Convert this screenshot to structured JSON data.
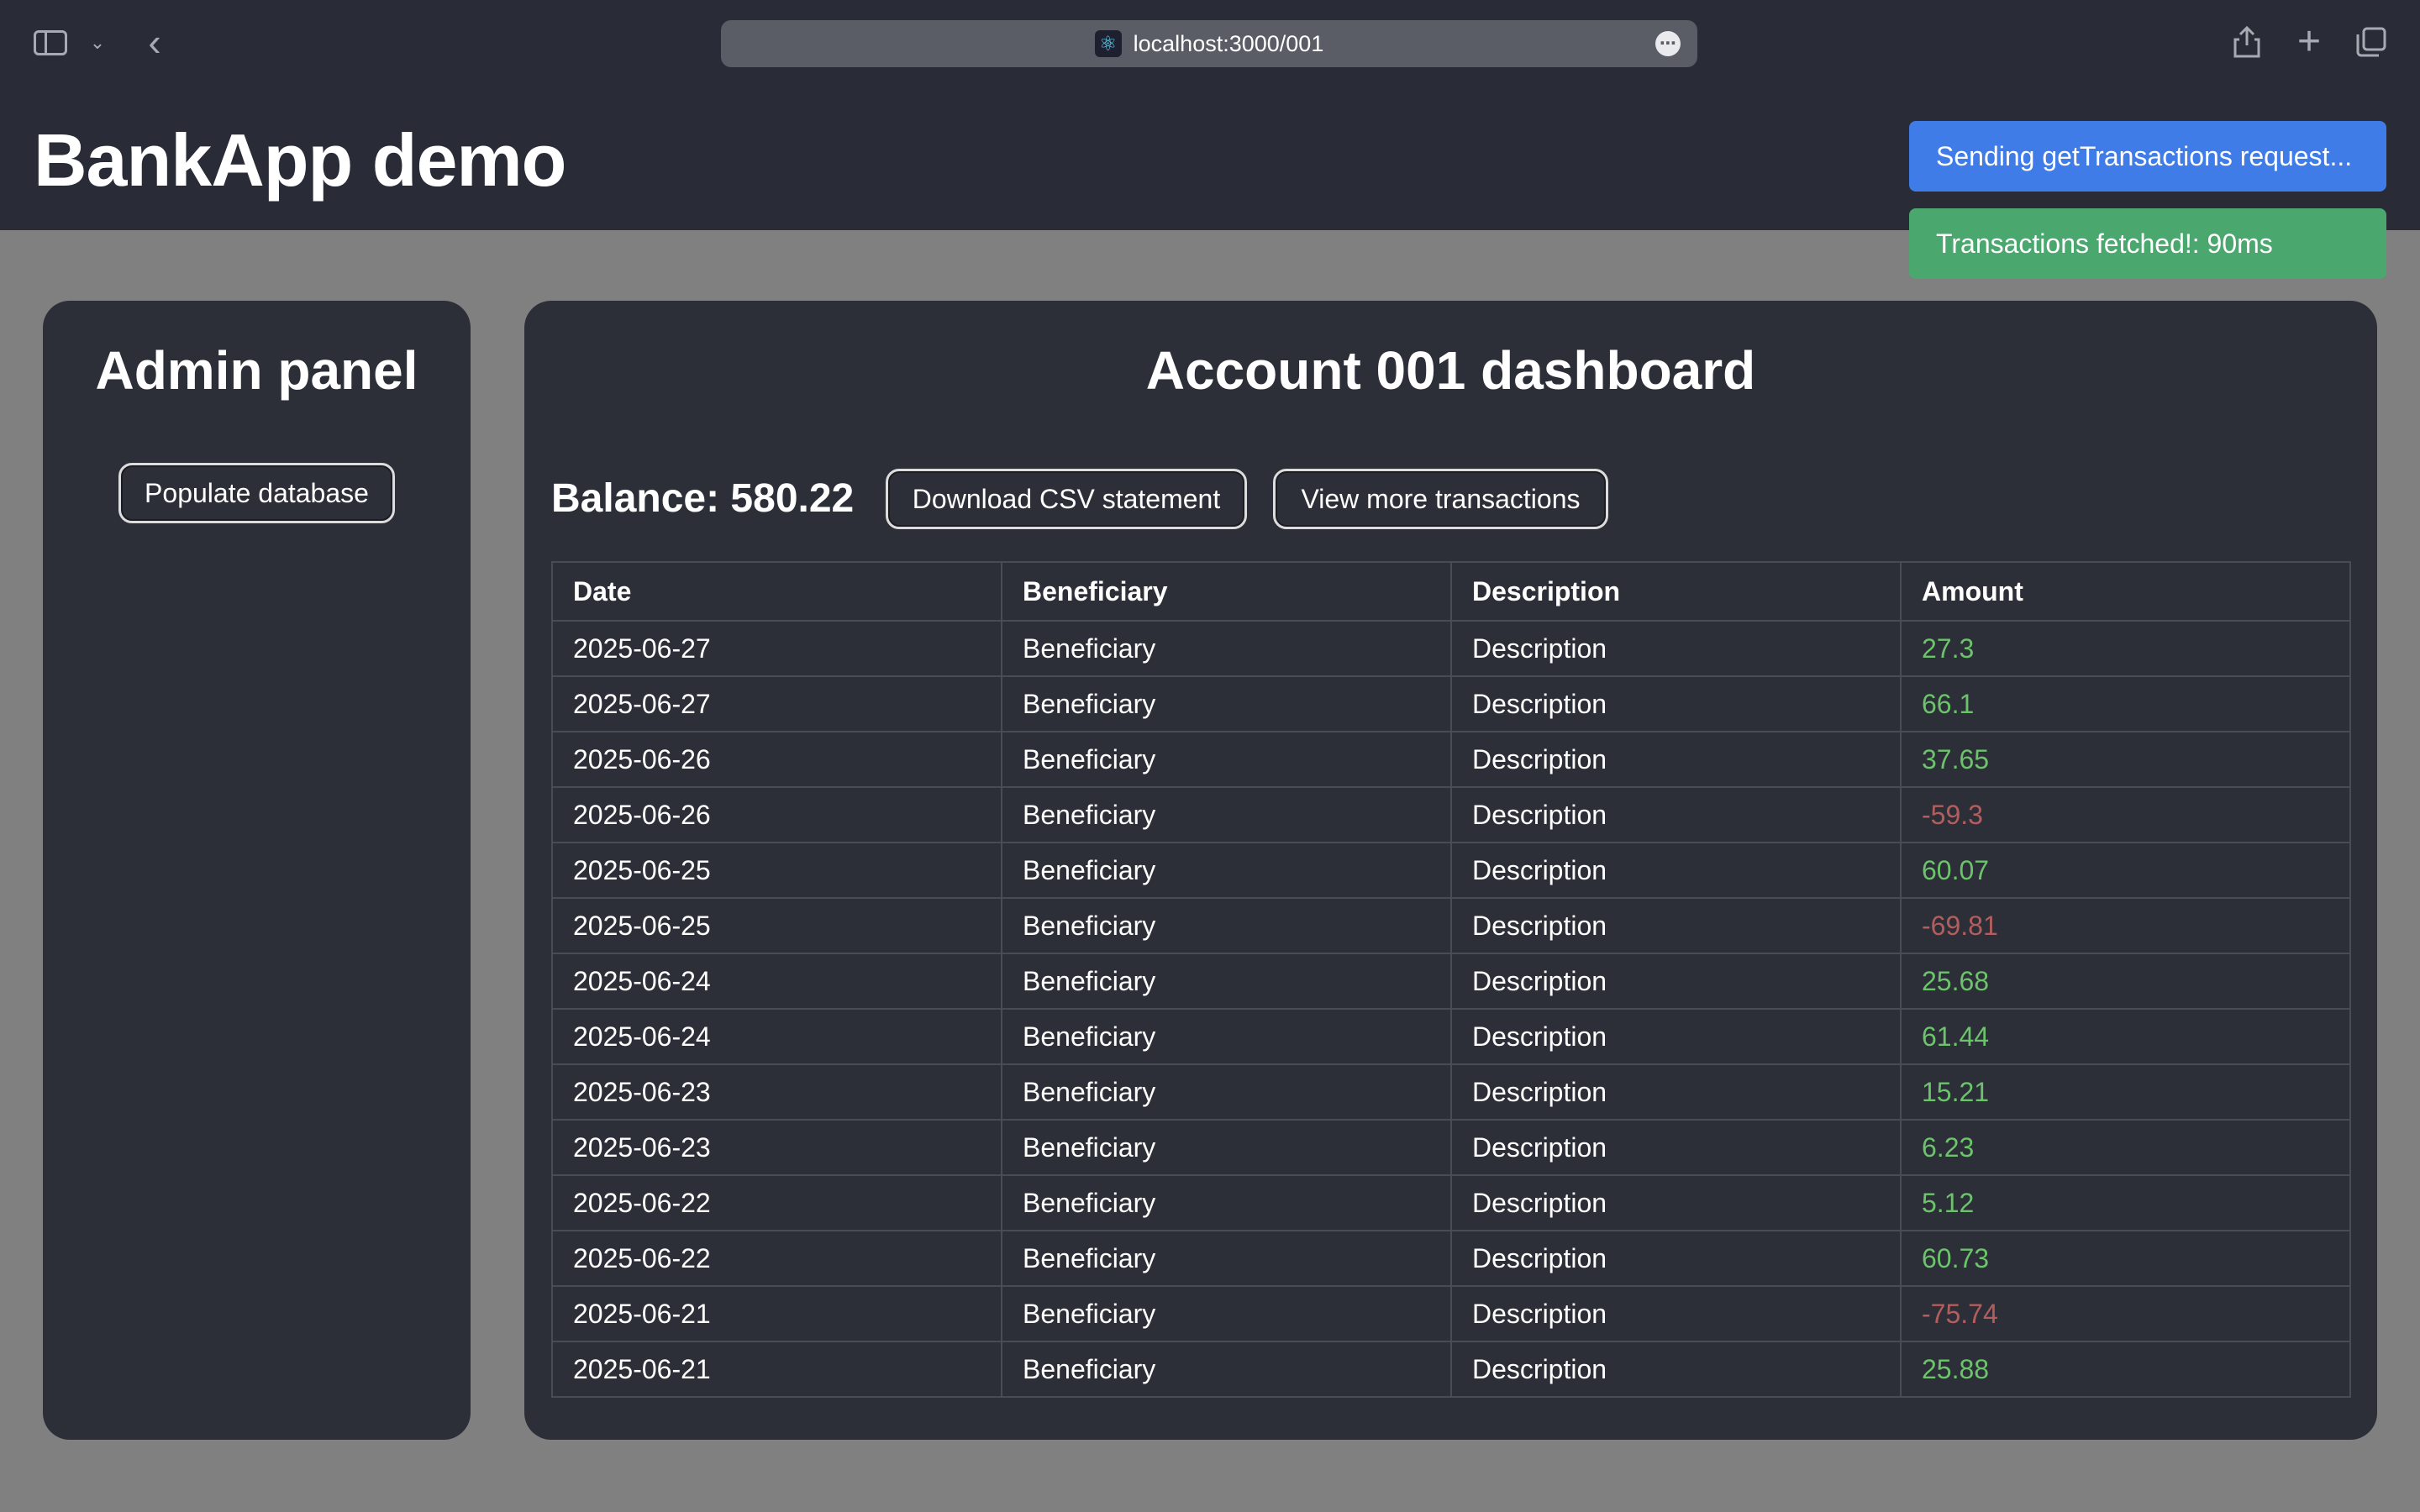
{
  "browser": {
    "url": "localhost:3000/001",
    "icons": [
      "sidebar-icon",
      "chevron-down-icon",
      "back-icon",
      "react-favicon",
      "more-icon",
      "share-icon",
      "plus-icon",
      "tabs-icon"
    ]
  },
  "app": {
    "title": "BankApp demo"
  },
  "toasts": [
    {
      "text": "Sending getTransactions request...",
      "color": "#3f7ce8"
    },
    {
      "text": "Transactions fetched!: 90ms",
      "color": "#4aa86e"
    }
  ],
  "admin": {
    "title": "Admin panel",
    "populate_label": "Populate database"
  },
  "dashboard": {
    "title": "Account 001 dashboard",
    "balance": "Balance: 580.22",
    "csv_label": "Download CSV statement",
    "more_label": "View more transactions",
    "columns": [
      "Date",
      "Beneficiary",
      "Description",
      "Amount"
    ],
    "rows": [
      {
        "date": "2025-06-27",
        "beneficiary": "Beneficiary",
        "description": "Description",
        "amount": "27.3"
      },
      {
        "date": "2025-06-27",
        "beneficiary": "Beneficiary",
        "description": "Description",
        "amount": "66.1"
      },
      {
        "date": "2025-06-26",
        "beneficiary": "Beneficiary",
        "description": "Description",
        "amount": "37.65"
      },
      {
        "date": "2025-06-26",
        "beneficiary": "Beneficiary",
        "description": "Description",
        "amount": "-59.3"
      },
      {
        "date": "2025-06-25",
        "beneficiary": "Beneficiary",
        "description": "Description",
        "amount": "60.07"
      },
      {
        "date": "2025-06-25",
        "beneficiary": "Beneficiary",
        "description": "Description",
        "amount": "-69.81"
      },
      {
        "date": "2025-06-24",
        "beneficiary": "Beneficiary",
        "description": "Description",
        "amount": "25.68"
      },
      {
        "date": "2025-06-24",
        "beneficiary": "Beneficiary",
        "description": "Description",
        "amount": "61.44"
      },
      {
        "date": "2025-06-23",
        "beneficiary": "Beneficiary",
        "description": "Description",
        "amount": "15.21"
      },
      {
        "date": "2025-06-23",
        "beneficiary": "Beneficiary",
        "description": "Description",
        "amount": "6.23"
      },
      {
        "date": "2025-06-22",
        "beneficiary": "Beneficiary",
        "description": "Description",
        "amount": "5.12"
      },
      {
        "date": "2025-06-22",
        "beneficiary": "Beneficiary",
        "description": "Description",
        "amount": "60.73"
      },
      {
        "date": "2025-06-21",
        "beneficiary": "Beneficiary",
        "description": "Description",
        "amount": "-75.74"
      },
      {
        "date": "2025-06-21",
        "beneficiary": "Beneficiary",
        "description": "Description",
        "amount": "25.88"
      }
    ],
    "colors": {
      "positive": "#6cc36c",
      "negative": "#b35e5e"
    }
  }
}
